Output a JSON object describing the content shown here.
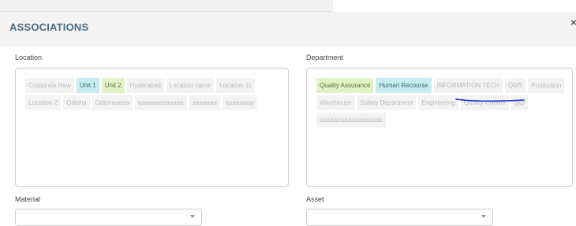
{
  "modal": {
    "title": "ASSOCIATIONS",
    "close_glyph": "×"
  },
  "location": {
    "label": "Location",
    "tags": [
      {
        "text": "Corporate New",
        "state": "default"
      },
      {
        "text": "Unit 1",
        "state": "selected-teal"
      },
      {
        "text": "Unit 2",
        "state": "selected-green"
      },
      {
        "text": "Hyderabad",
        "state": "default"
      },
      {
        "text": "Location name",
        "state": "default"
      },
      {
        "text": "Location 11",
        "state": "default"
      },
      {
        "text": "Location-2",
        "state": "default"
      },
      {
        "text": "Odisha",
        "state": "default"
      },
      {
        "text": "Odishaaaaa",
        "state": "default"
      },
      {
        "text": "aaaaaaaaaaaaa",
        "state": "default"
      },
      {
        "text": "aaaaaaa",
        "state": "default"
      },
      {
        "text": "aaaaaaaa",
        "state": "default"
      }
    ]
  },
  "department": {
    "label": "Department",
    "tags": [
      {
        "text": "Quality Assurance",
        "state": "selected-green"
      },
      {
        "text": "Human Recourse",
        "state": "selected-teal"
      },
      {
        "text": "INFORMATION TECH",
        "state": "default"
      },
      {
        "text": "QMS",
        "state": "default"
      },
      {
        "text": "Production",
        "state": "default"
      },
      {
        "text": "Warehouse",
        "state": "default"
      },
      {
        "text": "Safety Department",
        "state": "default"
      },
      {
        "text": "Engineering",
        "state": "default"
      },
      {
        "text": "Quality Control",
        "state": "default"
      },
      {
        "text": "gxp",
        "state": "default"
      },
      {
        "text": "aaaaaaaaaaaaaaaaaa",
        "state": "default"
      }
    ]
  },
  "material": {
    "label": "Material",
    "selected_value": ""
  },
  "asset": {
    "label": "Asset",
    "selected_value": ""
  },
  "colors": {
    "title": "#4a6a84",
    "tag_default_bg": "#f3f3f3",
    "tag_default_text": "#b9b9b9",
    "tag_teal_bg": "#c6ecef",
    "tag_teal_text": "#3f6670",
    "tag_green_bg": "#e2f2c6",
    "tag_green_text": "#5c7336",
    "annotation_stroke": "#1a2bd0"
  },
  "icons": {
    "close": "close-icon",
    "dropdown": "chevron-down-icon"
  }
}
